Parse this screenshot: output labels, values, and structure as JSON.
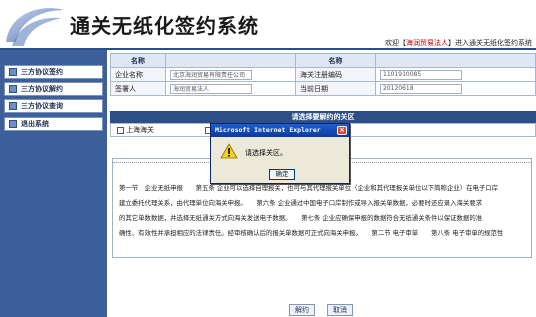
{
  "header": {
    "title": "通关无纸化签约系统",
    "welcome_prefix": "欢迎【",
    "welcome_user": "海润贸易法人",
    "welcome_suffix": "】进入通关无纸化签约系统"
  },
  "sidebar": {
    "items": [
      {
        "label": "三方协议签约",
        "icon": "bullet-icon"
      },
      {
        "label": "三方协议解约",
        "icon": "bullet-icon"
      },
      {
        "label": "三方协议查询",
        "icon": "bullet-icon"
      },
      {
        "label": "退出系统",
        "icon": "bullet-icon"
      }
    ]
  },
  "form": {
    "col_header_1": "名称",
    "col_header_2": "名称",
    "enterprise_label": "企业名称",
    "enterprise_value": "北京海润贸易有限责任公司",
    "customs_code_label": "海关注册编码",
    "customs_code_value": "1101910085",
    "signer_label": "签署人",
    "signer_value": "海润贸易法人",
    "date_label": "当前日期",
    "date_value": "20120618"
  },
  "customs_section": {
    "title": "请选择要解约的关区",
    "options": [
      {
        "label": "上海海关",
        "checked": false
      },
      {
        "label": "",
        "checked": false
      }
    ]
  },
  "agreement_text": {
    "lines": [
      "第一节　企业无纸申报　　第五条 企业可以选择自理报关，也可与其代理报关单位（企业和其代理报关单位以下简称企业）在电子口岸",
      "建立委托代理关系，由代理单位向海关申报。　　第六条 企业通过中国电子口岸制作或导入报关单数据，必要时还应录入海关要求",
      "的其它单数数据，并选择无纸通关方式向海关发送电子数据。　　第七条 企业应确保申报的数据符合无纸通关条件以保证数据的准",
      "确性、有效性并承担相应的法律责任。经审核确认后的报关单数据可正式向海关申报。　　第二节 电子审单　　第八条 电子审单的规范性"
    ]
  },
  "buttons": {
    "terminate": "解约",
    "cancel": "取消"
  },
  "dialog": {
    "title": "Microsoft Internet Explorer",
    "message": "请选择关区。",
    "ok": "确定",
    "icon": "warning-icon"
  },
  "colors": {
    "sidebar": "#3d5f9a",
    "section_bar": "#2d4e87",
    "accent_red": "#c00000"
  }
}
